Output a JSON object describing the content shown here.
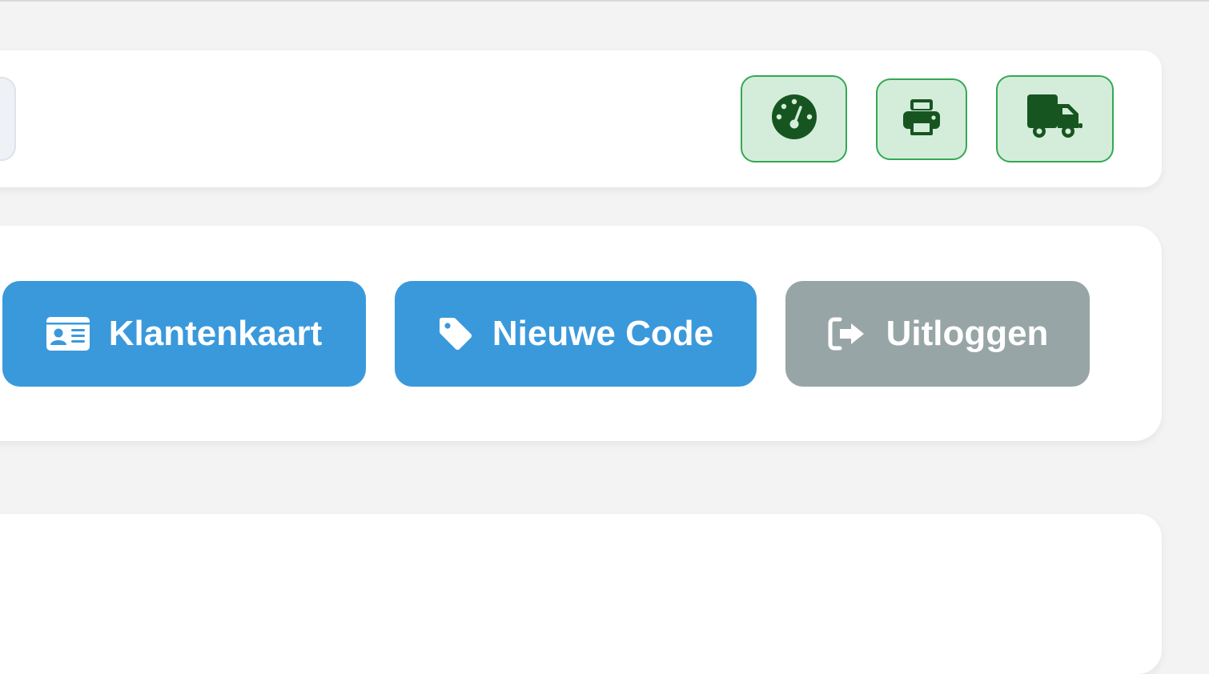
{
  "colors": {
    "page_background": "#f3f3f3",
    "card_background": "#ffffff",
    "icon_button_background": "#d4eddb",
    "icon_button_border": "#34a853",
    "icon_color": "#175520",
    "primary": "#3a99db",
    "secondary": "#98a5a6"
  },
  "toolbar": {
    "icon_buttons": [
      {
        "icon": "dashboard-gauge-icon"
      },
      {
        "icon": "print-icon"
      },
      {
        "icon": "truck-icon"
      }
    ]
  },
  "actions": {
    "customer_card": {
      "label": "Klantenkaart",
      "icon": "id-card-icon"
    },
    "new_code": {
      "label": "Nieuwe Code",
      "icon": "tag-icon"
    },
    "logout": {
      "label": "Uitloggen",
      "icon": "sign-out-icon"
    }
  }
}
